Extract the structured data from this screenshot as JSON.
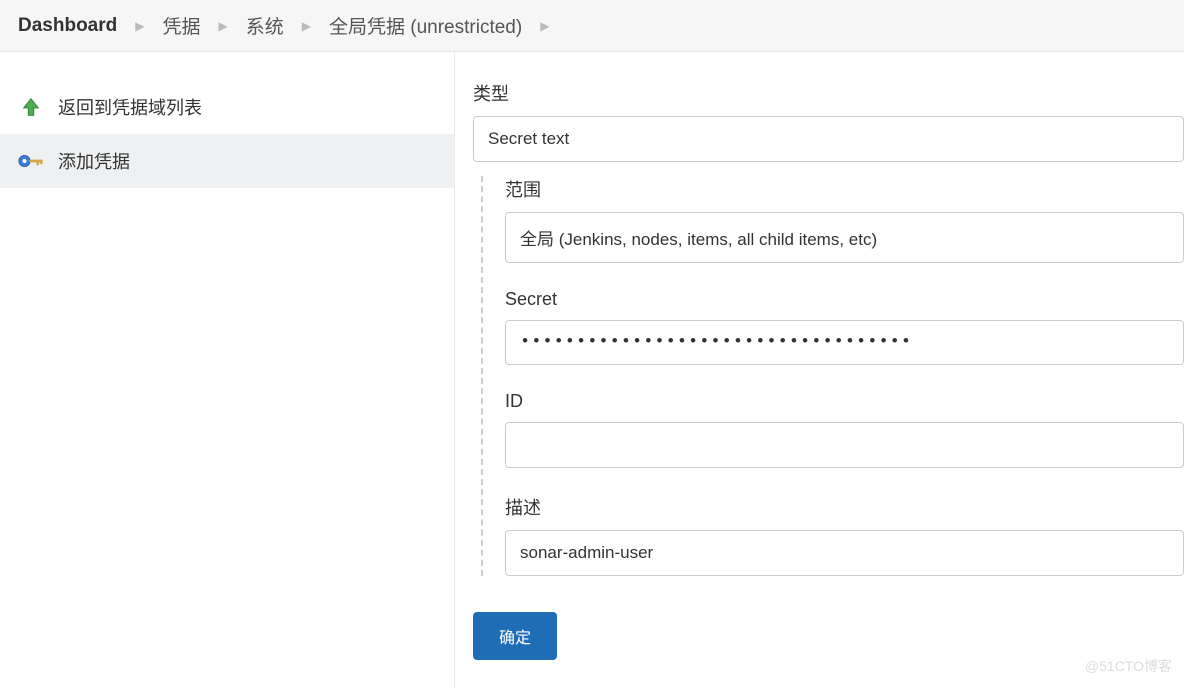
{
  "breadcrumb": {
    "items": [
      {
        "label": "Dashboard",
        "bold": true
      },
      {
        "label": "凭据"
      },
      {
        "label": "系统"
      },
      {
        "label": "全局凭据 (unrestricted)"
      }
    ]
  },
  "sidebar": {
    "items": [
      {
        "label": "返回到凭据域列表",
        "icon": "arrow-up",
        "active": false
      },
      {
        "label": "添加凭据",
        "icon": "key",
        "active": true
      }
    ]
  },
  "form": {
    "type_label": "类型",
    "type_value": "Secret text",
    "scope_label": "范围",
    "scope_value": "全局 (Jenkins, nodes, items, all child items, etc)",
    "secret_label": "Secret",
    "secret_value": "•••••••••••••••••••••••••••••••••••",
    "id_label": "ID",
    "id_value": "",
    "description_label": "描述",
    "description_value": "sonar-admin-user",
    "submit_label": "确定"
  },
  "watermark": "@51CTO博客"
}
